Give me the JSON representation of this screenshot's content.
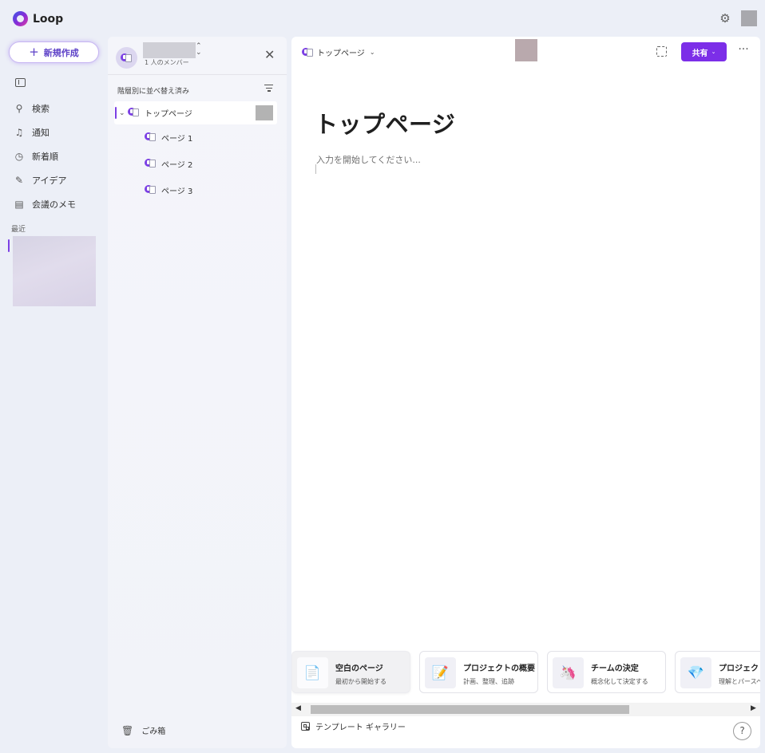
{
  "app": {
    "title": "Loop"
  },
  "left_nav": {
    "new_button_label": "新規作成",
    "items": [
      {
        "label": "検索",
        "icon": "search-icon"
      },
      {
        "label": "通知",
        "icon": "bell-icon"
      },
      {
        "label": "新着順",
        "icon": "clock-icon"
      },
      {
        "label": "アイデア",
        "icon": "pen-icon"
      },
      {
        "label": "会議のメモ",
        "icon": "notes-icon"
      }
    ],
    "recent_label": "最近"
  },
  "workspace": {
    "members": "1 人のメンバー",
    "sort_label": "階層別に並べ替え済み",
    "tree": [
      {
        "label": "トップページ",
        "active": true
      },
      {
        "label": "ページ 1"
      },
      {
        "label": "ページ 2"
      },
      {
        "label": "ページ 3"
      }
    ],
    "trash_label": "ごみ箱"
  },
  "main": {
    "breadcrumb": "トップページ",
    "share_label": "共有",
    "page_title": "トップページ",
    "editor_placeholder": "入力を開始してください...",
    "templates": [
      {
        "name": "空白のページ",
        "desc": "最初から開始する",
        "icon": "📄"
      },
      {
        "name": "プロジェクトの概要",
        "desc": "計画、整理、追跡",
        "icon": "📝"
      },
      {
        "name": "チームの決定",
        "desc": "概念化して決定する",
        "icon": "🦄"
      },
      {
        "name": "プロジェクト",
        "desc": "理解とパースペ",
        "icon": "💎"
      }
    ],
    "gallery_label": "テンプレート ギャラリー",
    "help_label": "?"
  },
  "colors": {
    "accent": "#7c2ee8",
    "active_bar": "#7b3fe4"
  }
}
